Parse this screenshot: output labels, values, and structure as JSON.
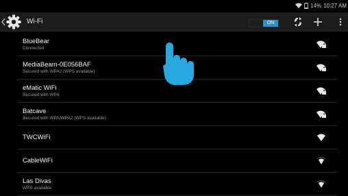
{
  "status_bar": {
    "battery_text": "14%",
    "time": "10:27 AM"
  },
  "header": {
    "title": "Wi-Fi",
    "toggle_label": "ON"
  },
  "networks": [
    {
      "ssid": "BlueBear",
      "status": "Connected",
      "secured": true
    },
    {
      "ssid": "MediaBeam-0E056BAF",
      "status": "Secured with WPA2 (WPS available)",
      "secured": true
    },
    {
      "ssid": "eMatic WiFi",
      "status": "Secured with WPA",
      "secured": true
    },
    {
      "ssid": "Batcave",
      "status": "Secured with WPA/WPA2 (WPS available)",
      "secured": true
    },
    {
      "ssid": "TWCWiFi",
      "status": "",
      "secured": false
    },
    {
      "ssid": "CableWiFi",
      "status": "",
      "secured": false
    },
    {
      "ssid": "Las Divas",
      "status": "WPS available",
      "secured": false
    }
  ],
  "icons": {
    "back": "chevron-left-icon",
    "settings": "gear-icon",
    "wps": "wps-icon",
    "add": "plus-icon",
    "overflow": "more-vert-icon",
    "pointer": "hand-pointer-icon"
  },
  "colors": {
    "accent": "#2f8fc6",
    "pointer": "#29a8e0",
    "background": "#000000"
  }
}
